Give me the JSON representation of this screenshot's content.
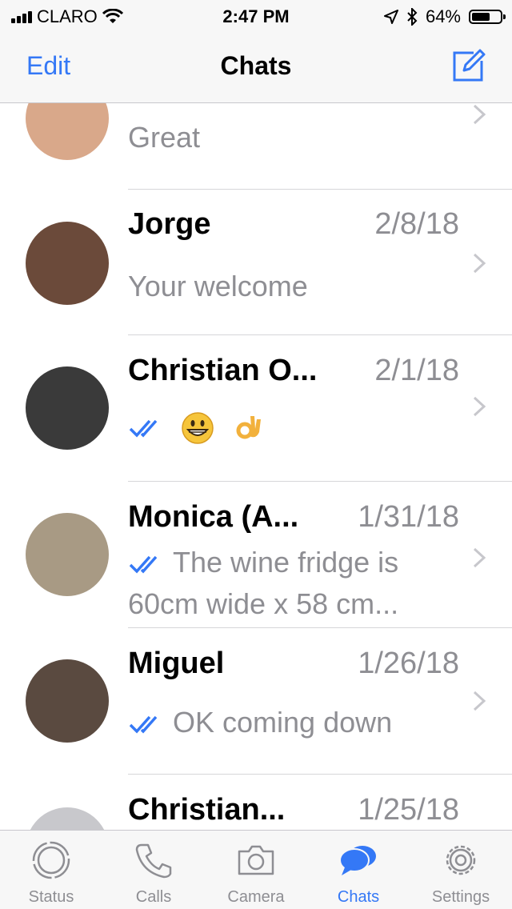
{
  "status_bar": {
    "carrier": "CLARO",
    "time": "2:47 PM",
    "battery_percent_text": "64%",
    "battery_level": 0.64
  },
  "nav": {
    "edit_label": "Edit",
    "title": "Chats"
  },
  "chats": [
    {
      "name": "",
      "date": "",
      "preview": "Great",
      "read_ticks": false,
      "avatar_color": "#d9a88a"
    },
    {
      "name": "Jorge",
      "date": "2/8/18",
      "preview": "Your welcome",
      "read_ticks": false,
      "avatar_color": "#6b4a3a"
    },
    {
      "name": "Christian O...",
      "date": "2/1/18",
      "preview": "",
      "read_ticks": true,
      "emojis": [
        "grinning-face-emoji",
        "ok-hand-emoji"
      ],
      "avatar_color": "#3a3a3a"
    },
    {
      "name": "Monica (A...",
      "date": "1/31/18",
      "preview": "The wine fridge is 60cm wide x 58 cm...",
      "read_ticks": true,
      "avatar_color": "#a89a84"
    },
    {
      "name": "Miguel",
      "date": "1/26/18",
      "preview": "OK coming down",
      "read_ticks": true,
      "avatar_color": "#5a4a40"
    },
    {
      "name": "Christian...",
      "date": "1/25/18",
      "preview": "",
      "read_ticks": false,
      "avatar_color": "#c8c8cc"
    }
  ],
  "tabs": [
    {
      "label": "Status",
      "icon": "status-icon",
      "active": false
    },
    {
      "label": "Calls",
      "icon": "phone-icon",
      "active": false
    },
    {
      "label": "Camera",
      "icon": "camera-icon",
      "active": false
    },
    {
      "label": "Chats",
      "icon": "chats-icon",
      "active": true
    },
    {
      "label": "Settings",
      "icon": "gear-icon",
      "active": false
    }
  ],
  "colors": {
    "accent": "#3478f6",
    "secondary_text": "#8e8e93",
    "bar_background": "#f7f7f7"
  }
}
